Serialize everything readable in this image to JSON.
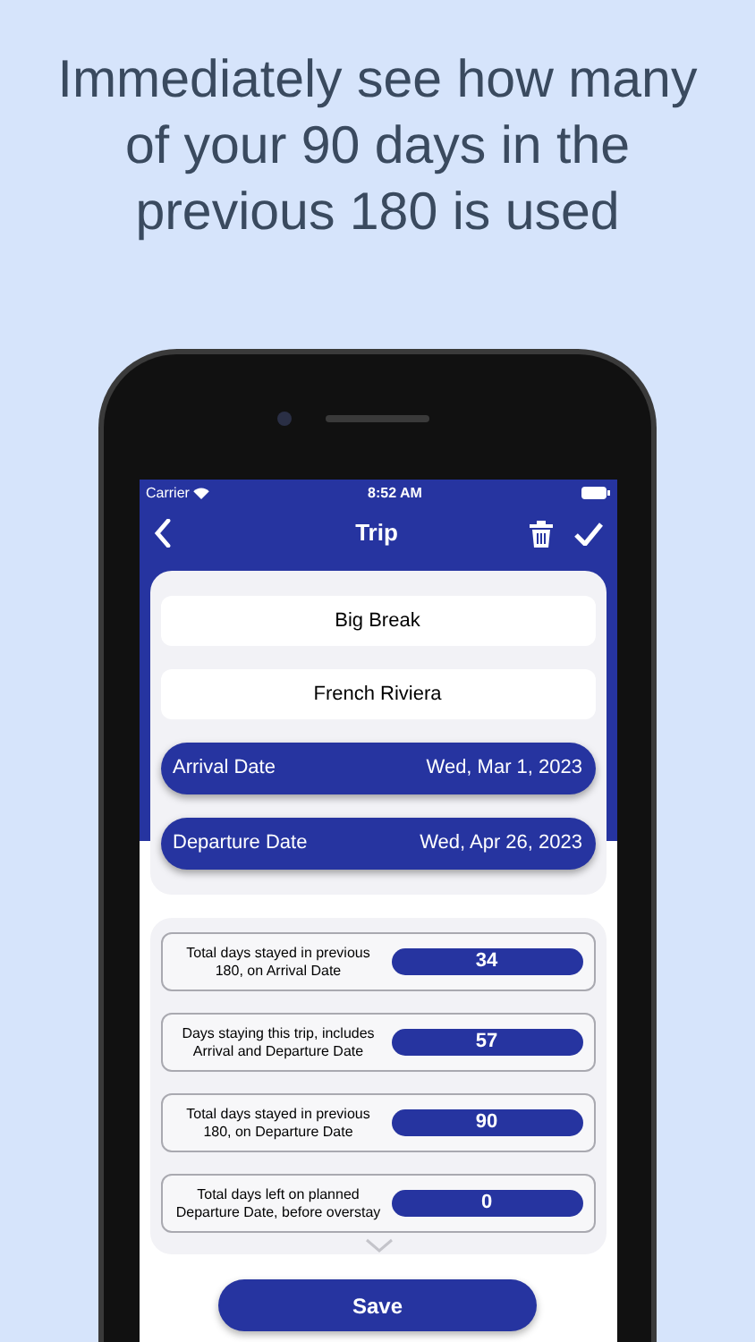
{
  "headline": "Immediately see how many of your 90 days in the previous 180 is used",
  "status_bar": {
    "carrier": "Carrier",
    "time": "8:52 AM"
  },
  "nav": {
    "title": "Trip"
  },
  "fields": [
    {
      "value": "Big Break"
    },
    {
      "value": "French Riviera"
    }
  ],
  "dates": [
    {
      "label": "Arrival Date",
      "value": "Wed, Mar 1, 2023"
    },
    {
      "label": "Departure Date",
      "value": "Wed, Apr 26, 2023"
    }
  ],
  "stats": [
    {
      "label": "Total days stayed in previous 180, on Arrival Date",
      "value": "34"
    },
    {
      "label": "Days staying this trip, includes Arrival and Departure Date",
      "value": "57"
    },
    {
      "label": "Total days stayed in previous 180, on Departure Date",
      "value": "90"
    },
    {
      "label": "Total days left on planned Departure Date, before overstay",
      "value": "0"
    }
  ],
  "save_button": "Save"
}
